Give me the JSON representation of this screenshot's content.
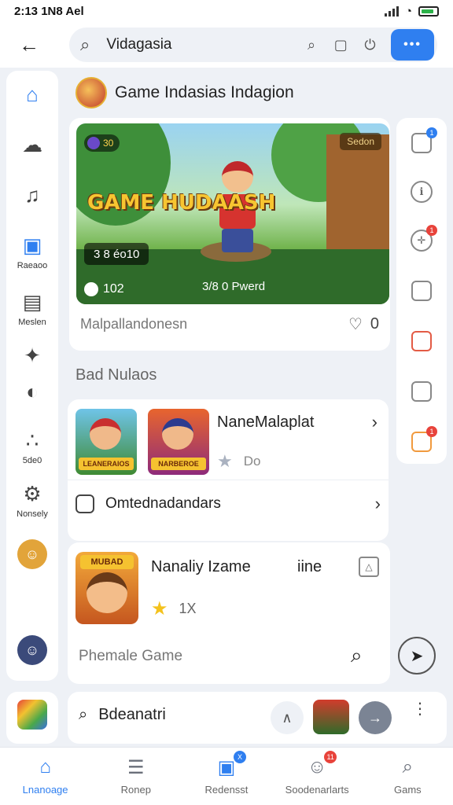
{
  "status": {
    "time": "2:13 1N8 Ael"
  },
  "search": {
    "value": "Vidagasia",
    "menu_label": "•••"
  },
  "left_rail": {
    "items": [
      {
        "label": ""
      },
      {
        "label": ""
      },
      {
        "label": ""
      },
      {
        "label": "Raeaoo"
      },
      {
        "label": "Meslen"
      },
      {
        "label": ""
      },
      {
        "label": ""
      },
      {
        "label": "5de0"
      },
      {
        "label": "Nonsely"
      }
    ]
  },
  "header": {
    "title": "Game Indasias Indagion"
  },
  "hero": {
    "logo": "GAME HUDAASH",
    "badge_left": "30",
    "badge_right": "Sedon",
    "pill": "3 8 éo10",
    "players": "102",
    "played": "3/8 0 Pwerd",
    "meta": "Malpallandonesn",
    "likes": "0"
  },
  "section": {
    "title": "Bad Nulaos"
  },
  "recommended": {
    "thumb1_caption": "LEANERAIOS",
    "thumb2_caption": "NARBEROE",
    "title": "NaneMalaplat",
    "rating": "Do",
    "online_label": "Omtednadandars"
  },
  "featured": {
    "thumb_caption": "MUBAD",
    "title": "Nanaliy Izame",
    "extra": "iine",
    "rating": "1X",
    "input_placeholder": "Phemale Game"
  },
  "right_rail": {
    "badges": [
      "1",
      "1",
      "1"
    ]
  },
  "bottom_card": {
    "title": "Bdeanatri"
  },
  "tabs": [
    {
      "label": "Lnanoage",
      "active": true
    },
    {
      "label": "Ronep",
      "active": false
    },
    {
      "label": "Redensst",
      "active": false,
      "badge": "X"
    },
    {
      "label": "Soodenarlarts",
      "active": false,
      "badge": "11"
    },
    {
      "label": "Gams",
      "active": false
    }
  ],
  "colors": {
    "accent": "#2f7ff0",
    "badge": "#e8433b",
    "star": "#f4c21d"
  }
}
